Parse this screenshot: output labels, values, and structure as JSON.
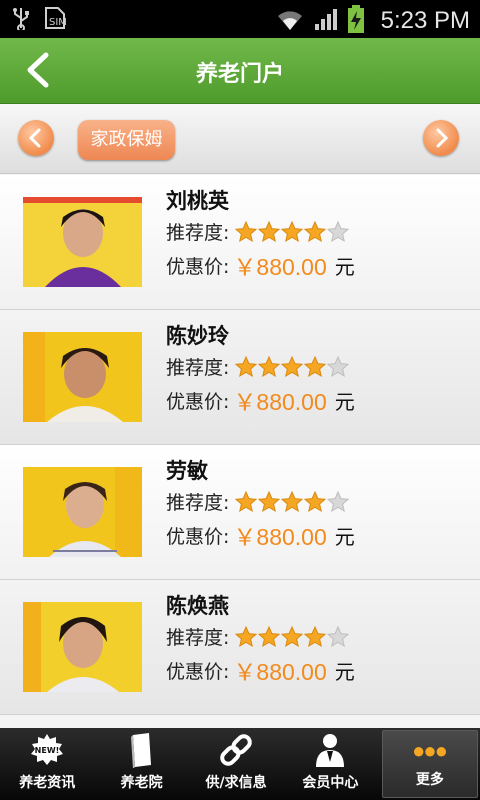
{
  "status_bar": {
    "time": "5:23 PM",
    "icons": [
      "usb-icon",
      "sim-icon",
      "wifi-icon",
      "signal-icon",
      "battery-charging-icon"
    ]
  },
  "header": {
    "title": "养老门户",
    "back_icon": "chevron-left-icon"
  },
  "category_bar": {
    "current": "家政保姆",
    "prev_icon": "chevron-left-icon",
    "next_icon": "chevron-right-icon"
  },
  "labels": {
    "rating": "推荐度:",
    "price": "优惠价:",
    "unit": "元"
  },
  "items": [
    {
      "name": "刘桃英",
      "rating": 4,
      "rating_max": 5,
      "price": "￥880.00"
    },
    {
      "name": "陈妙玲",
      "rating": 4,
      "rating_max": 5,
      "price": "￥880.00"
    },
    {
      "name": "劳敏",
      "rating": 4,
      "rating_max": 5,
      "price": "￥880.00"
    },
    {
      "name": "陈焕燕",
      "rating": 4,
      "rating_max": 5,
      "price": "￥880.00"
    }
  ],
  "tabs": [
    {
      "label": "养老资讯",
      "icon": "new-badge-icon"
    },
    {
      "label": "养老院",
      "icon": "book-icon"
    },
    {
      "label": "供/求信息",
      "icon": "link-icon"
    },
    {
      "label": "会员中心",
      "icon": "member-icon"
    },
    {
      "label": "更多",
      "icon": "more-dots-icon",
      "active": true
    }
  ],
  "colors": {
    "header_green": "#5aa836",
    "accent_orange": "#f28a1e",
    "star_gold": "#f5a623"
  }
}
